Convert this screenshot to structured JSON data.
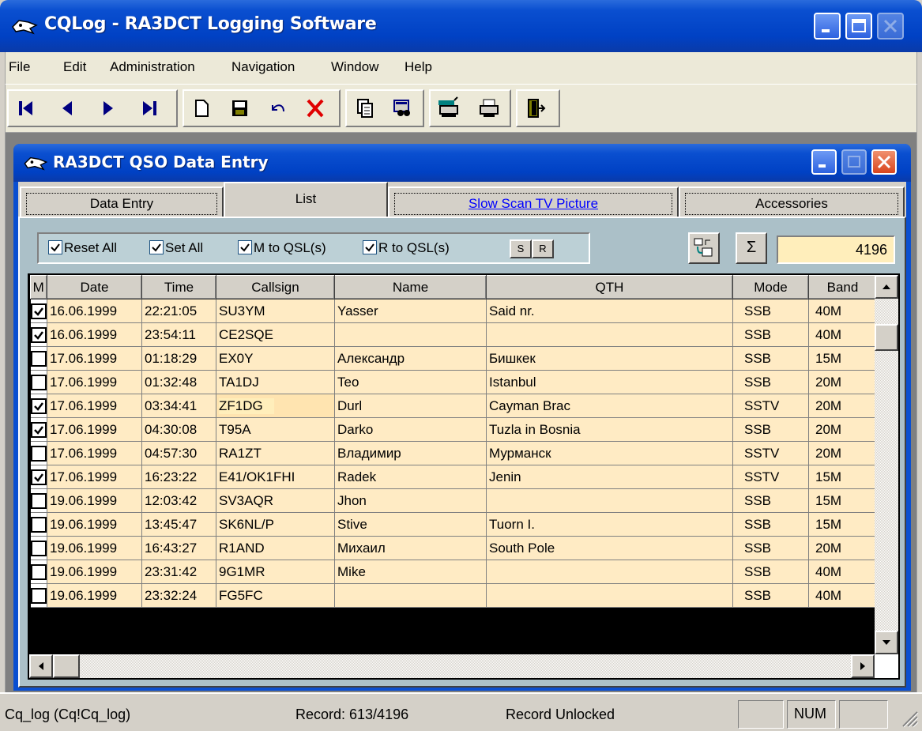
{
  "window": {
    "title": "CQLog - RA3DCT Logging Software"
  },
  "menu": [
    "File",
    "Edit",
    "Administration",
    "Navigation",
    "Window",
    "Help"
  ],
  "toolbar": {
    "buttons": [
      "first-record-icon",
      "prev-record-icon",
      "next-record-icon",
      "last-record-icon",
      "new-record-icon",
      "save-record-icon",
      "undo-icon",
      "delete-icon",
      "copy-icon",
      "search-icon",
      "printer-setup-icon",
      "print-icon",
      "exit-icon"
    ]
  },
  "child": {
    "title": "RA3DCT QSO Data Entry"
  },
  "tabs": [
    "Data Entry",
    "List",
    "Slow Scan TV Picture",
    "Accessories"
  ],
  "filters": {
    "reset_all": "Reset All",
    "set_all": "Set All",
    "m_to_qsl": "M to QSL(s)",
    "r_to_qsl": "R to QSL(s)",
    "s_btn": "S",
    "r_btn": "R",
    "sigma": "Σ",
    "count": "4196"
  },
  "grid": {
    "columns": [
      "M",
      "Date",
      "Time",
      "Callsign",
      "Name",
      "QTH",
      "Mode",
      "Band"
    ],
    "rows": [
      {
        "m": true,
        "date": "16.06.1999",
        "time": "22:21:05",
        "call": "SU3YM",
        "name": "Yasser",
        "qth": "Said nr.",
        "mode": "SSB",
        "band": "40M"
      },
      {
        "m": true,
        "date": "16.06.1999",
        "time": "23:54:11",
        "call": "CE2SQE",
        "name": "",
        "qth": "",
        "mode": "SSB",
        "band": "40M"
      },
      {
        "m": false,
        "date": "17.06.1999",
        "time": "01:18:29",
        "call": "EX0Y",
        "name": "Александр",
        "qth": "Бишкек",
        "mode": "SSB",
        "band": "15M"
      },
      {
        "m": false,
        "date": "17.06.1999",
        "time": "01:32:48",
        "call": "TA1DJ",
        "name": "Teo",
        "qth": "Istanbul",
        "mode": "SSB",
        "band": "20M"
      },
      {
        "m": true,
        "date": "17.06.1999",
        "time": "03:34:41",
        "call": "ZF1DG",
        "name": "Durl",
        "qth": "Cayman Brac",
        "mode": "SSTV",
        "band": "20M"
      },
      {
        "m": true,
        "date": "17.06.1999",
        "time": "04:30:08",
        "call": "T95A",
        "name": "Darko",
        "qth": "Tuzla in Bosnia",
        "mode": "SSB",
        "band": "20M"
      },
      {
        "m": false,
        "date": "17.06.1999",
        "time": "04:57:30",
        "call": "RA1ZT",
        "name": "Владимир",
        "qth": "Мурманск",
        "mode": "SSTV",
        "band": "20M"
      },
      {
        "m": true,
        "date": "17.06.1999",
        "time": "16:23:22",
        "call": "E41/OK1FHI",
        "name": "Radek",
        "qth": "Jenin",
        "mode": "SSTV",
        "band": "15M"
      },
      {
        "m": false,
        "date": "19.06.1999",
        "time": "12:03:42",
        "call": "SV3AQR",
        "name": "Jhon",
        "qth": "",
        "mode": "SSB",
        "band": "15M"
      },
      {
        "m": false,
        "date": "19.06.1999",
        "time": "13:45:47",
        "call": "SK6NL/P",
        "name": "Stive",
        "qth": "Tuorn I.",
        "mode": "SSB",
        "band": "15M"
      },
      {
        "m": false,
        "date": "19.06.1999",
        "time": "16:43:27",
        "call": "R1AND",
        "name": "Михаил",
        "qth": "South Pole",
        "mode": "SSB",
        "band": "20M"
      },
      {
        "m": false,
        "date": "19.06.1999",
        "time": "23:31:42",
        "call": "9G1MR",
        "name": "Mike",
        "qth": "",
        "mode": "SSB",
        "band": "40M"
      },
      {
        "m": false,
        "date": "19.06.1999",
        "time": "23:32:24",
        "call": "FG5FC",
        "name": "",
        "qth": "",
        "mode": "SSB",
        "band": "40M"
      }
    ]
  },
  "status": {
    "db": "Cq_log (Cq!Cq_log)",
    "record": "Record: 613/4196",
    "lock": "Record Unlocked",
    "num": "NUM"
  }
}
